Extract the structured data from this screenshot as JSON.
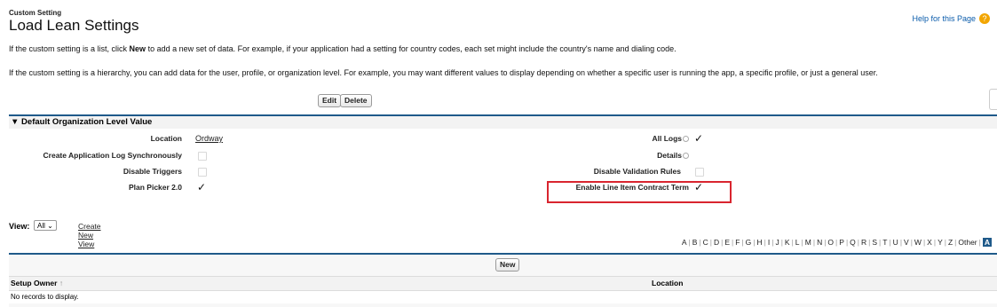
{
  "header": {
    "breadcrumb": "Custom Setting",
    "title": "Load Lean Settings",
    "help_link": "Help for this Page"
  },
  "descriptions": {
    "line1_prefix": "If the custom setting is a list, click ",
    "line1_bold": "New",
    "line1_suffix": " to add a new set of data. For example, if your application had a setting for country codes, each set might include the country's name and dialing code.",
    "line2": "If the custom setting is a hierarchy, you can add data for the user, profile, or organization level. For example, you may want different values to display depending on whether a specific user is running the app, a specific profile, or just a general user."
  },
  "toolbar": {
    "edit_label": "Edit",
    "delete_label": "Delete"
  },
  "section": {
    "title": "Default Organization Level Value",
    "left_fields": [
      {
        "label": "Location",
        "value": "Ordway",
        "type": "link"
      },
      {
        "label": "Create Application Log Synchronously",
        "value": false,
        "type": "checkbox"
      },
      {
        "label": "Disable Triggers",
        "value": false,
        "type": "checkbox"
      },
      {
        "label": "Plan Picker 2.0",
        "value": true,
        "type": "checkbox"
      }
    ],
    "right_fields": [
      {
        "label": "All Logs",
        "value": true,
        "type": "checkbox",
        "info": true
      },
      {
        "label": "Details",
        "value": "",
        "type": "text",
        "info": true
      },
      {
        "label": "Disable Validation Rules",
        "value": false,
        "type": "checkbox"
      },
      {
        "label": "Enable Line Item Contract Term",
        "value": true,
        "type": "checkbox",
        "highlighted": true
      }
    ]
  },
  "view": {
    "label": "View:",
    "selected": "All",
    "create_link": "Create New View"
  },
  "alphabet": [
    "A",
    "B",
    "C",
    "D",
    "E",
    "F",
    "G",
    "H",
    "I",
    "J",
    "K",
    "L",
    "M",
    "N",
    "O",
    "P",
    "Q",
    "R",
    "S",
    "T",
    "U",
    "V",
    "W",
    "X",
    "Y",
    "Z",
    "Other",
    "All"
  ],
  "alphabet_active": "All",
  "alphabet_active_display": "A",
  "list": {
    "new_label": "New",
    "columns": [
      "Setup Owner",
      "Location"
    ],
    "sort_indicator": "↑",
    "empty_message": "No records to display."
  },
  "colors": {
    "accent": "#1f5a8a",
    "highlight_box": "#d9252f",
    "help_badge": "#f2a500",
    "link": "#0b5cab"
  }
}
